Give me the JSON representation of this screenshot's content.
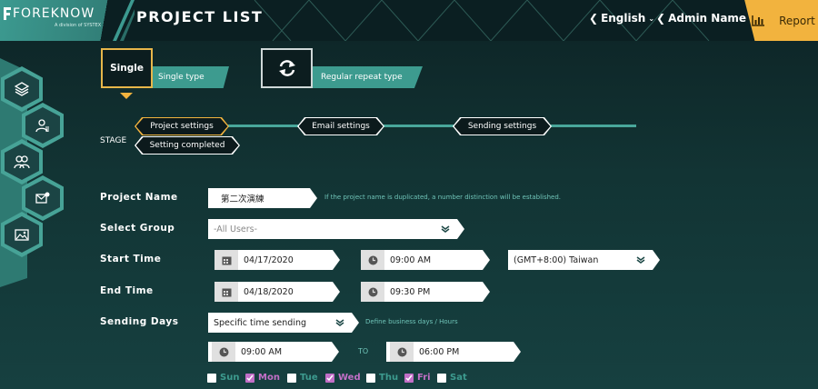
{
  "header": {
    "logo_text": "FOREKNOW",
    "logo_sub": "A division of SYSTEX",
    "title": "PROJECT LIST",
    "language": "English",
    "user": "Admin Name",
    "report_label": "Report"
  },
  "sidebar": {
    "icons": [
      "layers-icon",
      "user-list-icon",
      "users-icon",
      "mail-settings-icon",
      "image-map-icon"
    ]
  },
  "types": {
    "single_card": "Single",
    "single_label": "Single type",
    "repeat_label": "Regular repeat type"
  },
  "stage": {
    "label": "STAGE",
    "steps": [
      "Project settings",
      "Email settings",
      "Sending settings"
    ],
    "completed": "Setting completed"
  },
  "form": {
    "project_name": {
      "label": "Project Name",
      "value": "第二次演練",
      "hint": "If the project name is duplicated, a number distinction will be established."
    },
    "select_group": {
      "label": "Select Group",
      "placeholder": "-All Users-"
    },
    "start_time": {
      "label": "Start Time",
      "date": "04/17/2020",
      "time": "09:00 AM",
      "timezone": "(GMT+8:00) Taiwan"
    },
    "end_time": {
      "label": "End Time",
      "date": "04/18/2020",
      "time": "09:30 PM"
    },
    "sending_days": {
      "label": "Sending Days",
      "mode": "Specific time sending",
      "hint": "Define business days / Hours",
      "from": "09:00 AM",
      "to_label": "TO",
      "to": "06:00 PM"
    },
    "days": [
      {
        "label": "Sun",
        "checked": false
      },
      {
        "label": "Mon",
        "checked": true
      },
      {
        "label": "Tue",
        "checked": false
      },
      {
        "label": "Wed",
        "checked": true
      },
      {
        "label": "Thu",
        "checked": false
      },
      {
        "label": "Fri",
        "checked": true
      },
      {
        "label": "Sat",
        "checked": false
      }
    ]
  },
  "colors": {
    "accent": "#49a79b",
    "gold": "#f2b33e",
    "checked": "#c26fc7",
    "hint": "#6fc4b8"
  }
}
